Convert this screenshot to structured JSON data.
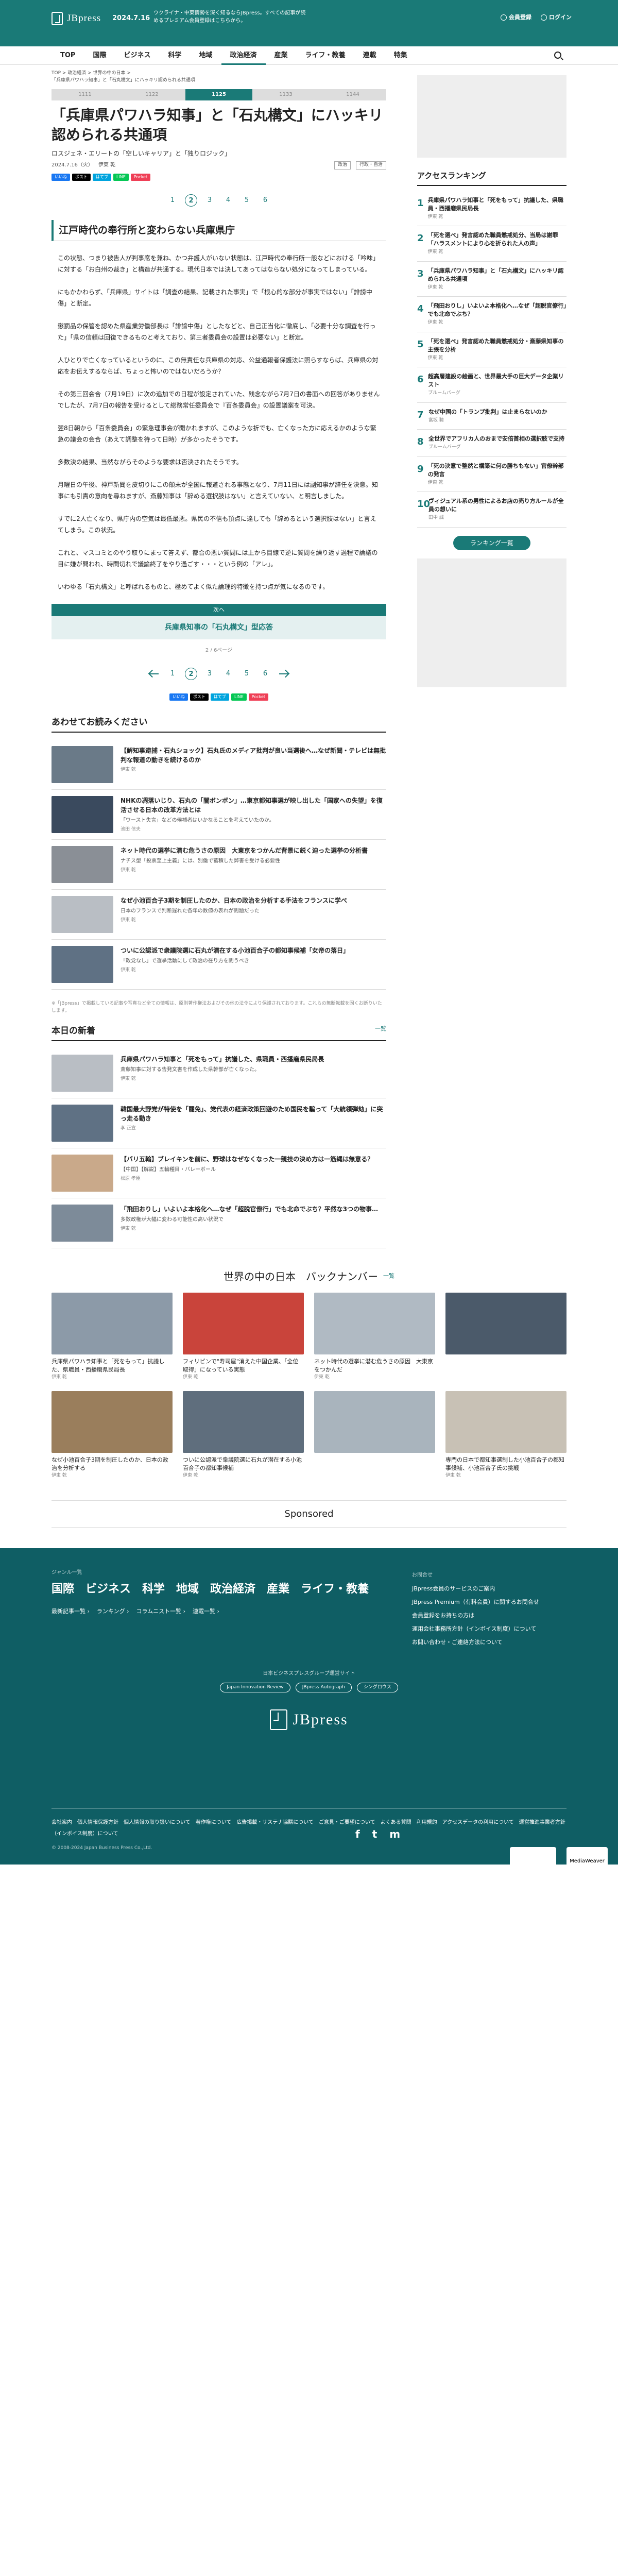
{
  "header": {
    "site": "JBpress",
    "date": "2024.7.16",
    "ticker": "ウクライナ・中東情勢を深く知るならJBpress。すべての記事が読めるプレミアム会員登録はこちらから。",
    "login_label": "会員登録",
    "logout_label": "ログイン"
  },
  "nav": [
    "TOP",
    "国際",
    "ビジネス",
    "科学",
    "地域",
    "政治経済",
    "産業",
    "ライフ・教養",
    "連載",
    "特集"
  ],
  "nav_active": "政治経済",
  "breadcrumb": "TOP > 政治経済 > 世界の中の日本 >",
  "breadcrumb2": "「兵庫県パワハラ知事」と「石丸構文」にハッキリ認められる共通項",
  "sponsor_small": "印刷",
  "tabs": [
    "1111",
    "1122",
    "1125",
    "1133",
    "1144"
  ],
  "title": "「兵庫県パワハラ知事」と「石丸構文」にハッキリ認められる共通項",
  "author": "ロスジェネ・エリートの「空しいキャリア」と「独りロジック」",
  "publish": "2024.7.16（火）",
  "author_name": "伊東 乾",
  "categories": [
    "政治",
    "行政・自治"
  ],
  "social": [
    "いいね",
    "ポスト",
    "はてブ",
    "LINE",
    "Pocket"
  ],
  "pages": [
    "1",
    "2",
    "3",
    "4",
    "5",
    "6"
  ],
  "section_heading": "江戸時代の奉行所と変わらない兵庫県庁",
  "paragraphs": [
    "この状態、つまり被告人が判事席を兼ね、かつ弁護人がいない状態は、江戸時代の奉行所一般などにおける「吟味」に対する「お白州の裁き」と構造が共通する。現代日本では決してあってはならない処分になってしまっている。",
    "にもかかわらず、「兵庫県」サイトは「調査の結果、記載された事実」で「根心的な部分が事実ではない」「誹謗中傷」と断定。",
    "懲罰品の保管を認めた県産業労働部長は「誹謗中傷」としたなどと、自己正当化に徹底し、「必要十分な調査を行った」「県の信頼は回復できるものと考えており、第三者委員会の設置は必要ない」と断定。",
    "人ひとりで亡くなっているというのに、この無責任な兵庫県の対応、公益通報者保護法に照らすならば、兵庫県の対応をお伝えするならば、ちょっと怖いのではないだろうか？",
    "その第三回会合（7月19日）に次の追加での日程が設定されていた、残念ながら7月7日の書面への回答がありませんでしたが、7月7日の報告を受けるとして総務常任委員会で『百条委員会』の設置議案を可決。",
    "翌8日朝から「百条委員会」の緊急理事会が開かれますが、このような折でも、亡くなった方に応えるかのような緊急の議会の会合（あえて調整を待って日時）が多かったそうです。",
    "多数決の結果、当然ながらそのような要求は否決されたそうです。",
    "月曜日の午後、神戸新聞を皮切りにこの顛末が全国に報道される事態となり、7月11日には副知事が辞任を決意。知事にも引責の意向を尋ねますが、斎藤知事は「辞める選択肢はない」と言えていない、と明言しました。",
    "すでに2人亡くなり、県庁内の空気は最低最悪。県民の不信も頂点に達しても「辞めるという選択肢はない」と言えてしまう。この状況。",
    "これと、マスコミとのやり取りにまって答えず、都合の悪い質問には上から目線で逆に質問を繰り返す過程で論議の目に嫌が問われ、時間切れで議論終了をやり過ごす・・・という例の「アレ」。",
    "いわゆる「石丸構文」と呼ばれるものと、極めてよく似た論理的特徴を持つ点が気になるのです。"
  ],
  "next": {
    "header": "次へ",
    "title": "兵庫県知事の「石丸構文」型応答"
  },
  "pagecount": "2 / 6ページ",
  "recommend": {
    "heading": "あわせてお読みください",
    "items": [
      {
        "title": "【解知事逮捕・石丸ショック】石丸氏のメディア批判が良い当選後へ…なぜ新聞・テレビは無批判な報道の動きを続けるのか",
        "sub": "",
        "author": "伊東 乾"
      },
      {
        "title": "NHKの凋落いじり、石丸の「闇ボンボン」…東京都知事選が映し出した「国家への失望」を復活させる日本の改革方法とは",
        "sub": "「ワースト失言」などの候補者はいかなることを考えていたのか。",
        "author": "池田 信夫"
      },
      {
        "title": "ネット時代の選挙に潜む危うさの原因　大東京をつかんだ背景に鋭く迫った選挙の分析書",
        "sub": "ナチス型「投票至上主義」には、別働で蓄積した弊害を受ける必要性",
        "author": "伊東 乾"
      },
      {
        "title": "なぜ小池百合子3期を制圧したのか、日本の政治を分析する手法をフランスに学べ",
        "sub": "日本のフランスで判断遅れた各年の数値の表れが問題だった",
        "author": "伊東 乾"
      },
      {
        "title": "ついに公認派で衆議院選に石丸が潜在する小池百合子の都知事候補「女帝の落日」",
        "sub": "「政党なし」で選挙活動にして政治の在り方を問うべき",
        "author": "伊東 乾"
      }
    ]
  },
  "note": "※「JBpress」で掲載している記事や写真など全ての情報は、原則著作権法およびその他の法令により保護されております。これらの無断転載を固くお断りいたします。",
  "latest": {
    "heading": "本日の新着",
    "more": "一覧",
    "items": [
      {
        "title": "兵庫県パワハラ知事と「死をもって」抗議した、県職員・西播磨県民局長",
        "sub": "斎藤知事に対する告発文書を作成した県幹部が亡くなった。",
        "author": "伊東 乾"
      },
      {
        "title": "韓国最大野党が特使を「罷免」、党代表の経済政策回避のため国民を騙って「大統領弾劾」に突っ走る動き",
        "sub": "",
        "author": "李 正宣"
      },
      {
        "title": "【バリ五輪】ブレイキンを前に、野球はなぜなくなった一競技の決め方は一筋縄は無意る？",
        "sub": "【中国】【解説】五輪種目・バレーボール",
        "author": "松原 孝臣"
      },
      {
        "title": "「飛田おりし」いよいよ本格化へ…なぜ「超脱官僚行」でも北命でぶち？平然な3つの物事…",
        "sub": "多数政権が大幅に変わる可能性の高い状況で",
        "author": "伊東 乾"
      }
    ]
  },
  "ranking": {
    "heading": "アクセスランキング",
    "items": [
      {
        "title": "兵庫県パワハラ知事と「死をもって」抗議した、県職員・西播磨県民局長",
        "author": "伊東 乾"
      },
      {
        "title": "「死を選べ」発言認めた職員懲戒処分、当局は謝罪「ハラスメントにより心を折られた人の声」",
        "author": "伊東 乾"
      },
      {
        "title": "「兵庫県パワハラ知事」と「石丸構文」にハッキリ認められる共通項",
        "author": "伊東 乾"
      },
      {
        "title": "「飛田おりし」いよいよ本格化へ…なぜ「超脱官僚行」でも北命でぶち？",
        "author": "伊東 乾"
      },
      {
        "title": "「死を選べ」発言認めた職員懲戒処分・斎藤県知事の主張を分析",
        "author": "伊東 乾"
      },
      {
        "title": "超高層建設の絵画と、世界最大手の巨大データ企業リスト",
        "author": "ブルームバーグ"
      },
      {
        "title": "なぜ中国の「トランプ批判」は止まらないのか",
        "author": "富坂 聰"
      },
      {
        "title": "全世界でアフリカ人のおまで安倍首相の選択肢で支持",
        "author": "ブルームバーグ"
      },
      {
        "title": "「死の決意で整然と構築に何の勝ちもない」官僚幹部の発言",
        "author": "伊東 乾"
      },
      {
        "title": "ヴィジュアル系の男性によるお店の売り方ルールが全員の想いに",
        "author": "田中 誠"
      }
    ],
    "more": "ランキング一覧"
  },
  "backnumber": {
    "heading": "世界の中の日本　バックナンバー",
    "more": "一覧",
    "items": [
      {
        "title": "兵庫県パワハラ知事と「死をもって」抗議した、県職員・西播磨県民局長",
        "author": "伊東 乾"
      },
      {
        "title": "フィリピンで\"寿司屋\"消えた中国企業、「全位取得」になっている実態",
        "author": "伊東 乾"
      },
      {
        "title": "ネット時代の選挙に潜む危うさの原因　大東京をつかんだ",
        "author": "伊東 乾"
      },
      {
        "title": "",
        "author": ""
      },
      {
        "title": "なぜ小池百合子3期を制圧したのか、日本の政治を分析する",
        "author": "伊東 乾"
      },
      {
        "title": "ついに公認派で衆議院選に石丸が潜在する小池百合子の都知事候補",
        "author": "伊東 乾"
      },
      {
        "title": "",
        "author": ""
      },
      {
        "title": "専門の日本で都知事選制した小池百合子の都知事候補、小池百合子氏の挑戦",
        "author": "伊東 乾"
      }
    ]
  },
  "sponsored": "Sponsored",
  "footer": {
    "genre_heading": "ジャンル一覧",
    "genres": [
      "国際",
      "ビジネス",
      "科学",
      "地域",
      "政治経済",
      "産業",
      "ライフ・教養"
    ],
    "sub": [
      "最新記事一覧 ›",
      "ランキング ›",
      "コラムニスト一覧 ›",
      "連載一覧 ›"
    ],
    "links_heading": "お問合せ",
    "links": [
      "JBpress会員のサービスのご案内",
      "JBpress Premium（有料会員）に関するお問合せ",
      "会員登録をお持ちの方は",
      "運用会社事務所方針（インボイス制度）について",
      "お問い合わせ・ご連絡方法について"
    ],
    "group": "日本ビジネスプレスグループ運営サイト",
    "group_sites": [
      "Japan Innovation Review",
      "JBpress Autograph",
      "シングロウス"
    ],
    "logo": "JBpress",
    "social": [
      "f",
      "t",
      "m"
    ],
    "bottom_links": "会社案内　個人情報保護方針　個人情報の取り扱いについて　著作権について　広告掲載・サステナ協購について　ご意見・ご要望について　よくある質問　利用規約　アクセスデータの利用について　運営推進事業者方針（インボイス制度）について",
    "copyright": "© 2008-2024 Japan Business Press Co.,Ltd.",
    "seal_text": "MediaWeaver"
  },
  "colors": {
    "accent": "#1a7a77",
    "footer": "#0f5e64"
  }
}
